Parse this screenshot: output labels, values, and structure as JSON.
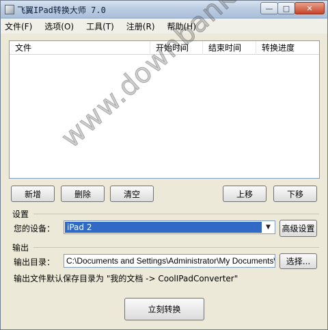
{
  "window": {
    "title": "飞翼IPad转换大师 7.0",
    "controls": {
      "minimize": "—",
      "maximize": "□",
      "close": "✕"
    }
  },
  "menu": [
    {
      "label": "文件(F)"
    },
    {
      "label": "选项(O)"
    },
    {
      "label": "工具(T)"
    },
    {
      "label": "注册(R)"
    },
    {
      "label": "帮助(H)"
    }
  ],
  "file_list": {
    "columns": [
      "文件",
      "开始时间",
      "结束时间",
      "转换进度"
    ],
    "rows": []
  },
  "list_buttons": {
    "add": "新增",
    "delete": "删除",
    "clear": "清空",
    "move_up": "上移",
    "move_down": "下移"
  },
  "settings": {
    "group_title": "设置",
    "device_label": "您的设备：",
    "device_value": "iPad 2",
    "advanced_button": "高级设置"
  },
  "output": {
    "group_title": "输出",
    "dir_label": "输出目录：",
    "dir_value": "C:\\Documents and Settings\\Administrator\\My Documents\\CoolIPadConverter",
    "browse_button": "选择...",
    "note": "输出文件默认保存目录为 \"我的文档 -> CoolIPadConverter\""
  },
  "convert_button": "立刻转换",
  "watermark": "www.downbank.cn"
}
